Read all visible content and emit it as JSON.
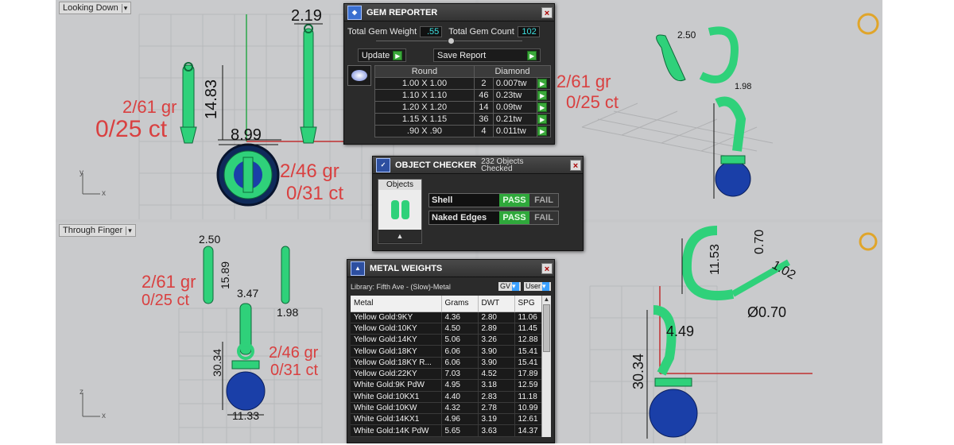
{
  "viewports": {
    "top_left_label": "Looking Down",
    "bottom_left_label": "Through Finger"
  },
  "annotations": {
    "tl_weight": "2/61 gr",
    "tl_carat": "0/25 ct",
    "tl_weight2": "2/46 gr",
    "tl_carat2": "0/31 ct",
    "tl_dim_width": "2.19",
    "tl_dim_height": "14.83",
    "tl_dim_diam": "8.99",
    "tr_weight": "2/61 gr",
    "tr_carat": "0/25 ct",
    "tr_dim_a": "2.50",
    "tr_dim_b": "1.98",
    "bl_weight": "2/61 gr",
    "bl_carat": "0/25 ct",
    "bl_weight2": "2/46 gr",
    "bl_carat2": "0/31 ct",
    "bl_dim_a": "2.50",
    "bl_dim_b": "15.89",
    "bl_dim_c": "3.47",
    "bl_dim_d": "1.98",
    "bl_dim_e": "30.34",
    "bl_dim_f": "11.33",
    "br_dim_a": "11.53",
    "br_dim_b": "0.70",
    "br_dim_c": "1.02",
    "br_dim_d": "Ø0.70",
    "br_dim_e": "4.49",
    "br_dim_f": "30.34"
  },
  "gem_reporter": {
    "title": "GEM REPORTER",
    "close": "×",
    "total_weight_label": "Total Gem Weight",
    "total_weight_value": ".55",
    "total_count_label": "Total Gem Count",
    "total_count_value": "102",
    "update_label": "Update",
    "save_label": "Save Report",
    "col_shape": "Round",
    "col_type": "Diamond",
    "rows": [
      {
        "size": "1.00 X 1.00",
        "count": "2",
        "weight": "0.007tw"
      },
      {
        "size": "1.10 X 1.10",
        "count": "46",
        "weight": "0.23tw"
      },
      {
        "size": "1.20 X 1.20",
        "count": "14",
        "weight": "0.09tw"
      },
      {
        "size": "1.15 X 1.15",
        "count": "36",
        "weight": "0.21tw"
      },
      {
        "size": ".90 X .90",
        "count": "4",
        "weight": "0.011tw"
      }
    ]
  },
  "object_checker": {
    "title": "OBJECT CHECKER",
    "count_text": "232 Objects Checked",
    "close": "×",
    "objects_label": "Objects",
    "checks": [
      {
        "name": "Shell",
        "pass": "PASS",
        "fail": "FAIL"
      },
      {
        "name": "Naked Edges",
        "pass": "PASS",
        "fail": "FAIL"
      }
    ]
  },
  "metal_weights": {
    "title": "METAL WEIGHTS",
    "close": "×",
    "library": "Library: Fifth Ave - (Slow)-Metal",
    "gv_label": "GV",
    "user_label": "User",
    "columns": [
      "Metal",
      "Grams",
      "DWT",
      "SPG"
    ],
    "rows": [
      [
        "Yellow Gold:9KY",
        "4.36",
        "2.80",
        "11.06"
      ],
      [
        "Yellow Gold:10KY",
        "4.50",
        "2.89",
        "11.45"
      ],
      [
        "Yellow Gold:14KY",
        "5.06",
        "3.26",
        "12.88"
      ],
      [
        "Yellow Gold:18KY",
        "6.06",
        "3.90",
        "15.41"
      ],
      [
        "Yellow Gold:18KY R...",
        "6.06",
        "3.90",
        "15.41"
      ],
      [
        "Yellow Gold:22KY",
        "7.03",
        "4.52",
        "17.89"
      ],
      [
        "White Gold:9K PdW",
        "4.95",
        "3.18",
        "12.59"
      ],
      [
        "White Gold:10KX1",
        "4.40",
        "2.83",
        "11.18"
      ],
      [
        "White Gold:10KW",
        "4.32",
        "2.78",
        "10.99"
      ],
      [
        "White Gold:14KX1",
        "4.96",
        "3.19",
        "12.61"
      ],
      [
        "White Gold:14K PdW",
        "5.65",
        "3.63",
        "14.37"
      ]
    ]
  },
  "colors": {
    "annotation_red": "#d94040",
    "jewel_green": "#2fd17a",
    "pearl_blue": "#1a3fa8",
    "panel_dark": "#2b2b2b",
    "pass_green": "#2fa83b"
  }
}
